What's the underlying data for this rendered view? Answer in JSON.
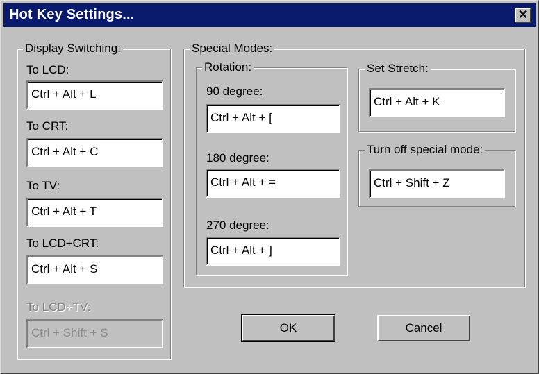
{
  "window": {
    "title": "Hot Key Settings...",
    "close_glyph": "✕"
  },
  "display_switching": {
    "legend": "Display Switching:",
    "items": [
      {
        "label": "To LCD:",
        "value": "Ctrl + Alt + L"
      },
      {
        "label": "To CRT:",
        "value": "Ctrl + Alt + C"
      },
      {
        "label": "To TV:",
        "value": "Ctrl + Alt + T"
      },
      {
        "label": "To LCD+CRT:",
        "value": "Ctrl + Alt + S"
      },
      {
        "label": "To LCD+TV:",
        "value": "Ctrl + Shift + S",
        "disabled": true
      }
    ]
  },
  "special_modes": {
    "legend": "Special Modes:",
    "rotation": {
      "legend": "Rotation:",
      "items": [
        {
          "label": "90 degree:",
          "value": "Ctrl + Alt + ["
        },
        {
          "label": "180 degree:",
          "value": "Ctrl + Alt + ="
        },
        {
          "label": "270 degree:",
          "value": "Ctrl + Alt + ]"
        }
      ]
    },
    "set_stretch": {
      "legend": "Set Stretch:",
      "value": "Ctrl + Alt + K"
    },
    "turn_off": {
      "legend": "Turn off special mode:",
      "value": "Ctrl + Shift + Z"
    }
  },
  "buttons": {
    "ok": "OK",
    "cancel": "Cancel"
  }
}
